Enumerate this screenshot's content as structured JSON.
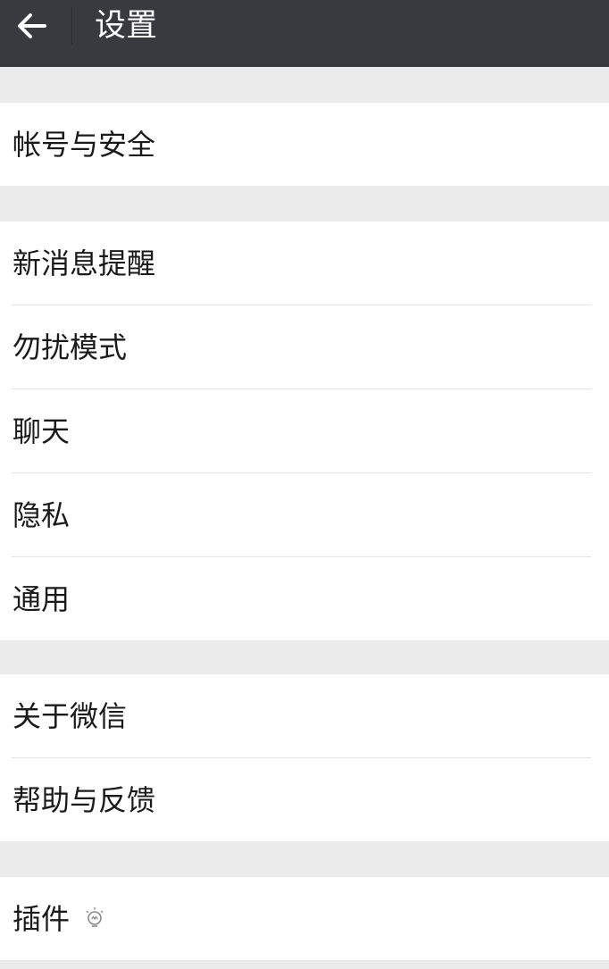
{
  "header": {
    "title": "设置"
  },
  "groups": [
    {
      "items": [
        {
          "label": "帐号与安全"
        }
      ]
    },
    {
      "items": [
        {
          "label": "新消息提醒"
        },
        {
          "label": "勿扰模式"
        },
        {
          "label": "聊天"
        },
        {
          "label": "隐私"
        },
        {
          "label": "通用"
        }
      ]
    },
    {
      "items": [
        {
          "label": "关于微信"
        },
        {
          "label": "帮助与反馈"
        }
      ]
    },
    {
      "items": [
        {
          "label": "插件",
          "icon": "lightbulb-icon"
        }
      ]
    }
  ]
}
